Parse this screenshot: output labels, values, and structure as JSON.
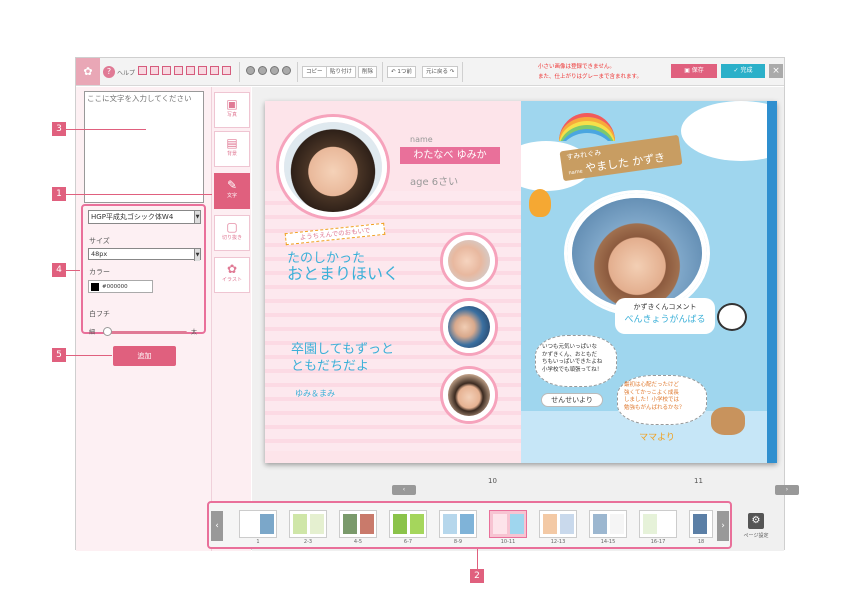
{
  "toolbar": {
    "logo": "✿",
    "help_label": "ヘルプ",
    "copy_label": "コピー",
    "paste_label": "貼り付け",
    "delete_label": "削除",
    "undo_label": "1つ前",
    "redo_label": "元に戻る",
    "notice_line1": "小さい画像は登録できません。",
    "notice_line2": "また、仕上がりはグレーまで含まれます。",
    "save_label": "保存",
    "done_label": "完成",
    "close_label": "×"
  },
  "left_panel": {
    "text_placeholder": "ここに文字を入力してください",
    "font_value": "HGP平成丸ゴシック体W4",
    "size_label": "サイズ",
    "size_value": "48px",
    "color_label": "カラー",
    "color_value": "#000000",
    "border_label": "白フチ",
    "thin_label": "細",
    "thick_label": "太",
    "add_button": "追加"
  },
  "tools": [
    {
      "label": "写真",
      "icon": "image-icon"
    },
    {
      "label": "背景",
      "icon": "background-icon"
    },
    {
      "label": "文字",
      "icon": "pencil-icon"
    },
    {
      "label": "切り抜き",
      "icon": "crop-icon"
    },
    {
      "label": "イラスト",
      "icon": "flower-icon"
    }
  ],
  "left_page": {
    "name_caption": "name",
    "name": "わたなべ ゆみか",
    "age": "age 6さい",
    "ribbon": "ようちえんでのおもいで",
    "text1_line1": "たのしかった",
    "text1_line2": "おとまりほいく",
    "text2_line1": "卒園してもずっと",
    "text2_line2": "ともだちだよ",
    "signature": "ゆみ＆まみ"
  },
  "right_page": {
    "class": "すみれぐみ",
    "name_caption": "name",
    "name": "やました かずき",
    "comment_title": "かずきくんコメント",
    "comment_text": "べんきょうがんばる",
    "msg1_line1": "いつも元気いっぱいな",
    "msg1_line2": "かずきくん、おともだ",
    "msg1_line3": "ちもいっぱいできたよね",
    "msg1_line4": "小学校でも頑張ってね！",
    "teacher_label": "せんせいより",
    "msg2_line1": "最初は心配だったけど",
    "msg2_line2": "強くてかっこよく成長",
    "msg2_line3": "しました！小学校では",
    "msg2_line4": "勉強もがんばれるかな？",
    "mama_label": "ママより"
  },
  "page_nav": {
    "prev": "‹",
    "next": "›",
    "left_num": "10",
    "right_num": "11"
  },
  "thumbnails": {
    "prev": "‹",
    "next": "›",
    "items": [
      "1",
      "2-3",
      "4-5",
      "6-7",
      "8-9",
      "10-11",
      "12-13",
      "14-15",
      "16-17",
      "18"
    ],
    "active": "10-11"
  },
  "page_setting_label": "ページ設定",
  "callouts": [
    "1",
    "2",
    "3",
    "4",
    "5"
  ],
  "colors": {
    "accent": "#e0607e",
    "done": "#2bb0c9"
  }
}
